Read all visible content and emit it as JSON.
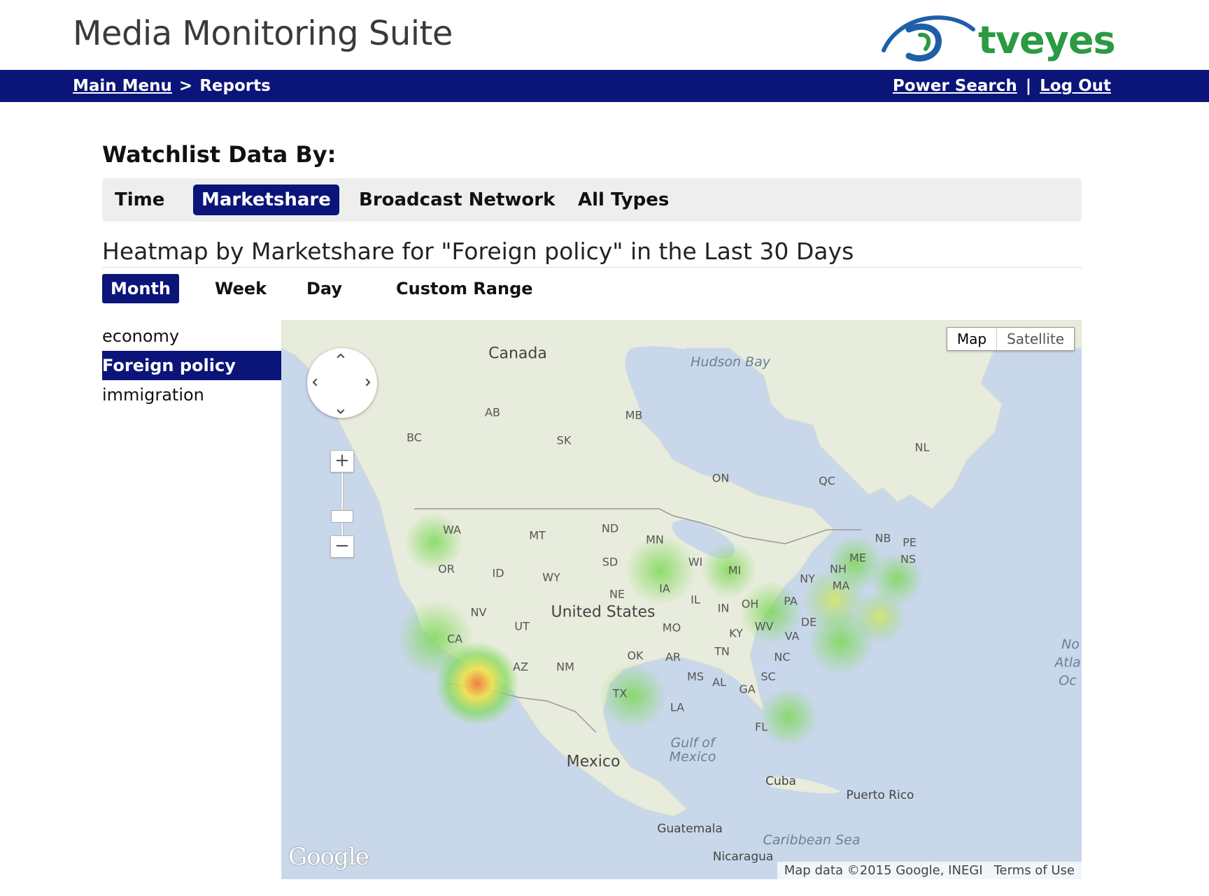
{
  "header": {
    "app_title": "Media Monitoring Suite",
    "logo_text": "tveyes"
  },
  "nav": {
    "main_menu": "Main Menu",
    "separator": ">",
    "current": "Reports",
    "power_search": "Power Search",
    "divider": "|",
    "log_out": "Log Out"
  },
  "watchlist": {
    "heading": "Watchlist Data By:",
    "tabs": [
      {
        "label": "Time",
        "active": false
      },
      {
        "label": "Marketshare",
        "active": true
      },
      {
        "label": "Broadcast Network",
        "active": false
      },
      {
        "label": "All Types",
        "active": false
      }
    ]
  },
  "report": {
    "title": "Heatmap by Marketshare for \"Foreign policy\" in the Last 30 Days",
    "ranges": [
      {
        "label": "Month",
        "active": true
      },
      {
        "label": "Week",
        "active": false
      },
      {
        "label": "Day",
        "active": false
      },
      {
        "label": "Custom Range",
        "active": false
      }
    ],
    "terms": [
      {
        "label": "economy",
        "active": false
      },
      {
        "label": "Foreign policy",
        "active": true
      },
      {
        "label": "immigration",
        "active": false
      }
    ]
  },
  "map": {
    "map_type": {
      "map": "Map",
      "satellite": "Satellite"
    },
    "zoom_in": "+",
    "zoom_out": "−",
    "google": "Google",
    "attribution": "Map data ©2015 Google, INEGI",
    "terms_link": "Terms of Use",
    "labels": {
      "canada": "Canada",
      "united_states": "United States",
      "mexico": "Mexico",
      "hudson_bay": "Hudson Bay",
      "gulf_of_mexico_1": "Gulf of",
      "gulf_of_mexico_2": "Mexico",
      "caribbean_sea": "Caribbean Sea",
      "north_atlantic_1": "No",
      "north_atlantic_2": "Atla",
      "north_atlantic_3": "Oc",
      "cuba": "Cuba",
      "puerto_rico": "Puerto Rico",
      "guatemala": "Guatemala",
      "nicaragua": "Nicaragua",
      "ab": "AB",
      "bc": "BC",
      "sk": "SK",
      "mb": "MB",
      "on": "ON",
      "qc": "QC",
      "nl": "NL",
      "nb": "NB",
      "pe": "PE",
      "ns": "NS",
      "wa": "WA",
      "or": "OR",
      "ca": "CA",
      "nv": "NV",
      "id": "ID",
      "mt": "MT",
      "wy": "WY",
      "ut": "UT",
      "az": "AZ",
      "nm": "NM",
      "nd": "ND",
      "sd": "SD",
      "ne": "NE",
      "ok": "OK",
      "tx": "TX",
      "mn": "MN",
      "ia": "IA",
      "mo": "MO",
      "ar": "AR",
      "la": "LA",
      "wi": "WI",
      "il": "IL",
      "mi": "MI",
      "in": "IN",
      "oh": "OH",
      "ky": "KY",
      "tn": "TN",
      "ms": "MS",
      "al": "AL",
      "ga": "GA",
      "fl": "FL",
      "sc": "SC",
      "nc": "NC",
      "va": "VA",
      "wv": "WV",
      "pa": "PA",
      "ny": "NY",
      "de": "DE",
      "nh": "NH",
      "ma": "MA",
      "me": "ME"
    },
    "heat_colors": {
      "low": "#7ed957",
      "mid": "#f2e24a",
      "high": "#f07a3a"
    }
  }
}
